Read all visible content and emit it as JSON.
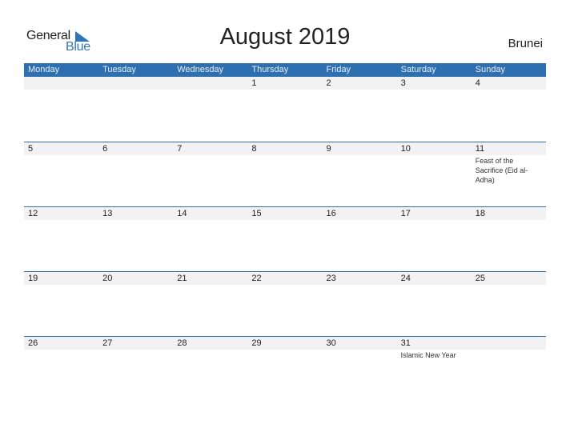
{
  "logo": {
    "word1": "General",
    "word2": "Blue"
  },
  "title": "August 2019",
  "country": "Brunei",
  "colors": {
    "accent": "#2e6fb0",
    "date_strip": "#f2f2f2"
  },
  "weekdays": [
    "Monday",
    "Tuesday",
    "Wednesday",
    "Thursday",
    "Friday",
    "Saturday",
    "Sunday"
  ],
  "weeks": [
    {
      "days": [
        {
          "num": "",
          "event": ""
        },
        {
          "num": "",
          "event": ""
        },
        {
          "num": "",
          "event": ""
        },
        {
          "num": "1",
          "event": ""
        },
        {
          "num": "2",
          "event": ""
        },
        {
          "num": "3",
          "event": ""
        },
        {
          "num": "4",
          "event": ""
        }
      ]
    },
    {
      "days": [
        {
          "num": "5",
          "event": ""
        },
        {
          "num": "6",
          "event": ""
        },
        {
          "num": "7",
          "event": ""
        },
        {
          "num": "8",
          "event": ""
        },
        {
          "num": "9",
          "event": ""
        },
        {
          "num": "10",
          "event": ""
        },
        {
          "num": "11",
          "event": "Feast of the Sacrifice (Eid al-Adha)"
        }
      ]
    },
    {
      "days": [
        {
          "num": "12",
          "event": ""
        },
        {
          "num": "13",
          "event": ""
        },
        {
          "num": "14",
          "event": ""
        },
        {
          "num": "15",
          "event": ""
        },
        {
          "num": "16",
          "event": ""
        },
        {
          "num": "17",
          "event": ""
        },
        {
          "num": "18",
          "event": ""
        }
      ]
    },
    {
      "days": [
        {
          "num": "19",
          "event": ""
        },
        {
          "num": "20",
          "event": ""
        },
        {
          "num": "21",
          "event": ""
        },
        {
          "num": "22",
          "event": ""
        },
        {
          "num": "23",
          "event": ""
        },
        {
          "num": "24",
          "event": ""
        },
        {
          "num": "25",
          "event": ""
        }
      ]
    },
    {
      "days": [
        {
          "num": "26",
          "event": ""
        },
        {
          "num": "27",
          "event": ""
        },
        {
          "num": "28",
          "event": ""
        },
        {
          "num": "29",
          "event": ""
        },
        {
          "num": "30",
          "event": ""
        },
        {
          "num": "31",
          "event": "Islamic New Year"
        },
        {
          "num": "",
          "event": ""
        }
      ]
    }
  ]
}
